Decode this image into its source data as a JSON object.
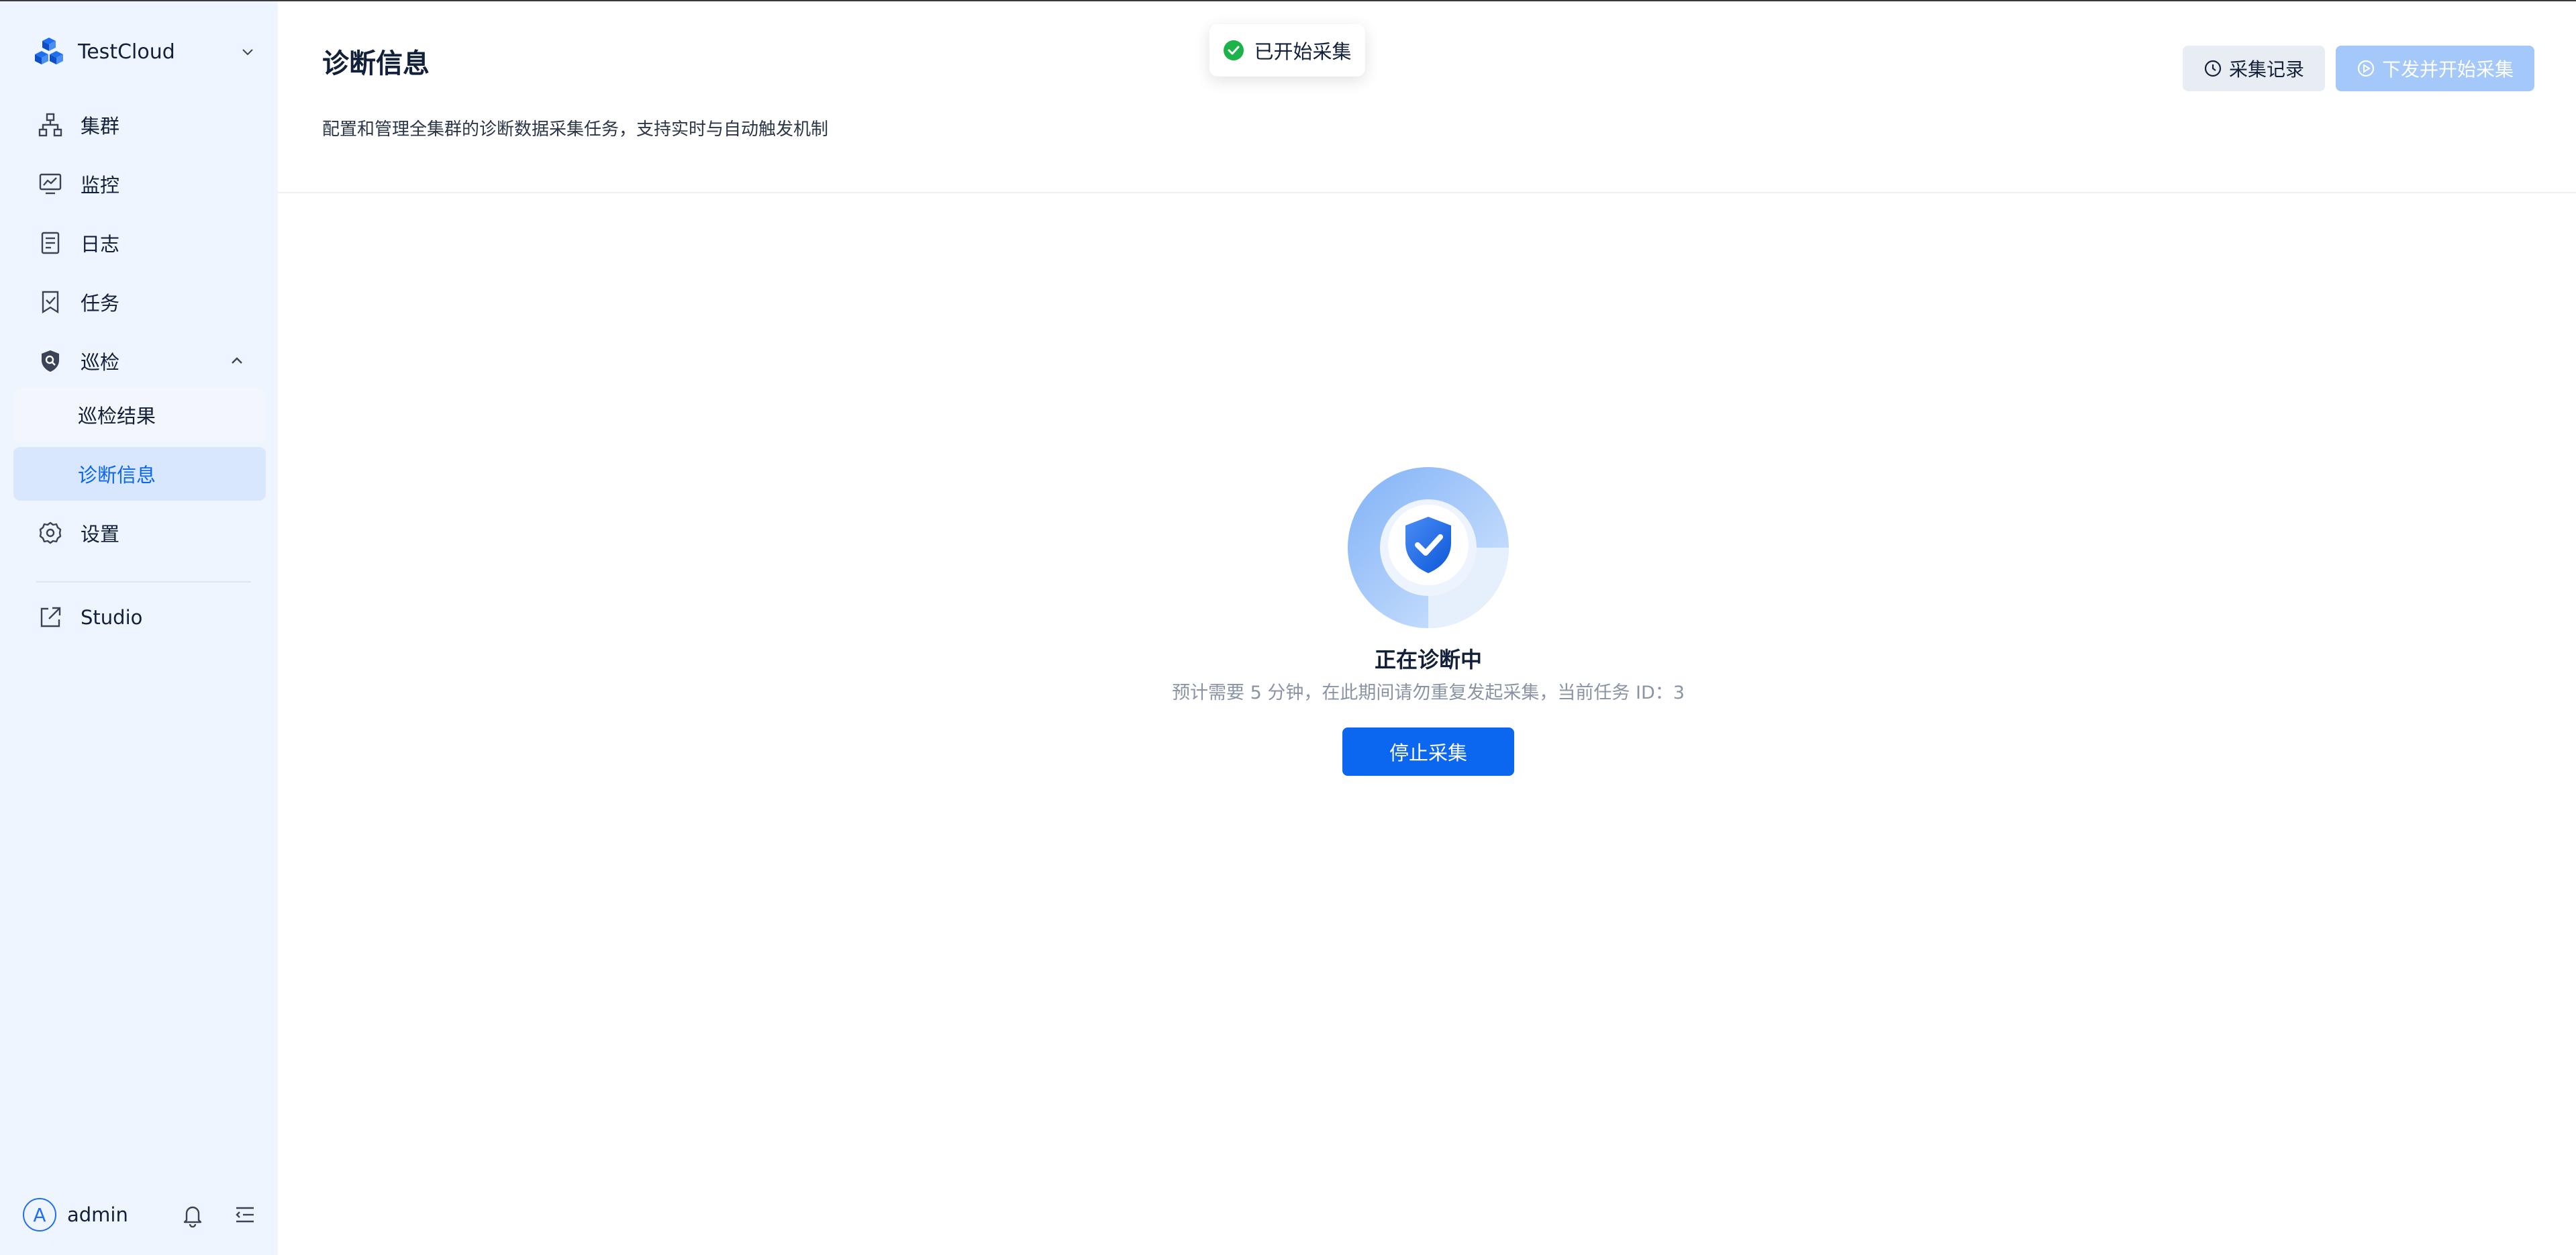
{
  "sidebar": {
    "brand": {
      "name": "TestCloud",
      "icon": "cubes-logo-icon"
    },
    "items": [
      {
        "label": "集群",
        "icon": "cluster-icon"
      },
      {
        "label": "监控",
        "icon": "monitor-icon"
      },
      {
        "label": "日志",
        "icon": "log-icon"
      },
      {
        "label": "任务",
        "icon": "task-icon"
      },
      {
        "label": "巡检",
        "icon": "shield-search-icon",
        "expanded": true,
        "children": [
          {
            "label": "巡检结果"
          },
          {
            "label": "诊断信息",
            "active": true
          }
        ]
      },
      {
        "label": "设置",
        "icon": "gear-icon"
      },
      {
        "label": "Studio",
        "icon": "external-link-icon"
      }
    ],
    "footer": {
      "avatar_letter": "A",
      "username": "admin"
    }
  },
  "header": {
    "title": "诊断信息",
    "subtitle": "配置和管理全集群的诊断数据采集任务，支持实时与自动触发机制",
    "history_button": "采集记录",
    "start_button": "下发并开始采集"
  },
  "toast": {
    "message": "已开始采集",
    "type": "success"
  },
  "status": {
    "title": "正在诊断中",
    "description": "预计需要 5 分钟，在此期间请勿重复发起采集，当前任务 ID：3",
    "stop_button": "停止采集"
  },
  "colors": {
    "primary": "#0b66f0",
    "primary_disabled": "#a3c8f9",
    "sidebar_bg": "#eef5fe",
    "active_bg": "#d8e7fc",
    "success": "#1db34a"
  }
}
